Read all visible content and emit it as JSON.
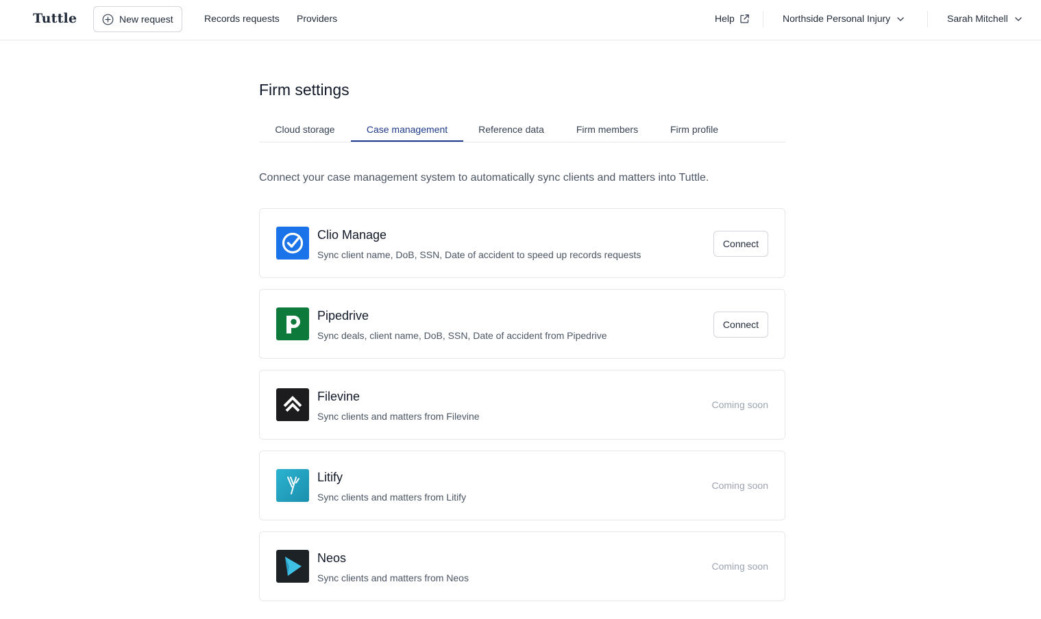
{
  "app": {
    "logo": "Tuttle"
  },
  "topbar": {
    "new_request_label": "New request",
    "nav": {
      "records_requests": "Records requests",
      "providers": "Providers"
    },
    "help_label": "Help",
    "firm_name": "Northside Personal Injury",
    "user_name": "Sarah Mitchell"
  },
  "page": {
    "title": "Firm settings",
    "tabs": [
      {
        "label": "Cloud storage",
        "active": false
      },
      {
        "label": "Case management",
        "active": true
      },
      {
        "label": "Reference data",
        "active": false
      },
      {
        "label": "Firm members",
        "active": false
      },
      {
        "label": "Firm profile",
        "active": false
      }
    ],
    "intro": "Connect your case management system to automatically sync clients and matters into Tuttle."
  },
  "integrations": [
    {
      "name": "Clio Manage",
      "description": "Sync client name, DoB, SSN, Date of accident to speed up records requests",
      "action": "Connect",
      "status": "available",
      "icon": "clio-logo-icon",
      "color": "#1a73e8"
    },
    {
      "name": "Pipedrive",
      "description": "Sync deals, client name, DoB, SSN, Date of accident from Pipedrive",
      "action": "Connect",
      "status": "available",
      "icon": "pipedrive-logo-icon",
      "color": "#0d7a3b"
    },
    {
      "name": "Filevine",
      "description": "Sync clients and matters from Filevine",
      "action": "Coming soon",
      "status": "coming_soon",
      "icon": "filevine-logo-icon",
      "color": "#1c1c1e"
    },
    {
      "name": "Litify",
      "description": "Sync clients and matters from Litify",
      "action": "Coming soon",
      "status": "coming_soon",
      "icon": "litify-logo-icon",
      "color": "#1e9bb8"
    },
    {
      "name": "Neos",
      "description": "Sync clients and matters from Neos",
      "action": "Coming soon",
      "status": "coming_soon",
      "icon": "neos-logo-icon",
      "color": "#1c2226"
    }
  ],
  "colors": {
    "accent": "#1e3a8a",
    "border": "#e5e7eb",
    "muted_text": "#9ca3af"
  }
}
